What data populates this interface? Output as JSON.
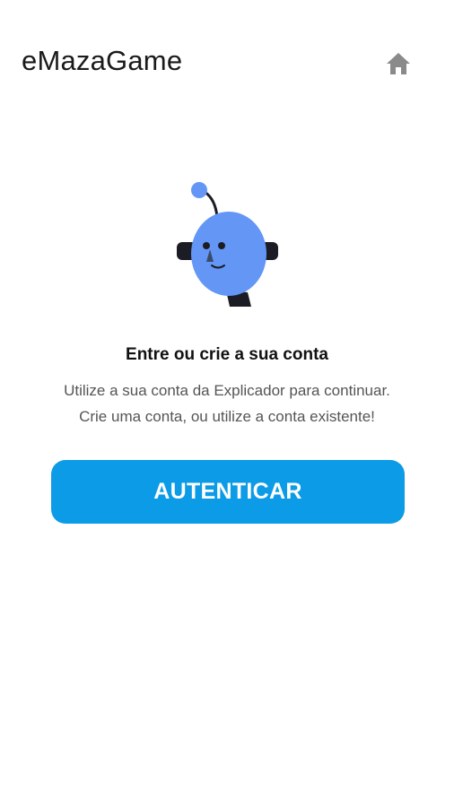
{
  "header": {
    "title": "eMazaGame",
    "home_icon": "home-icon"
  },
  "mascot": {
    "icon": "robot-mascot-illustration",
    "body_color": "#6496f6",
    "dark_color": "#1c1c24"
  },
  "login": {
    "heading": "Entre ou crie a sua conta",
    "line1": "Utilize a sua conta da Explicador para continuar.",
    "line2": "Crie uma conta, ou utilize a conta existente!",
    "button_label": "AUTENTICAR"
  },
  "colors": {
    "accent": "#0c9be6",
    "icon_gray": "#8a8a8a"
  }
}
